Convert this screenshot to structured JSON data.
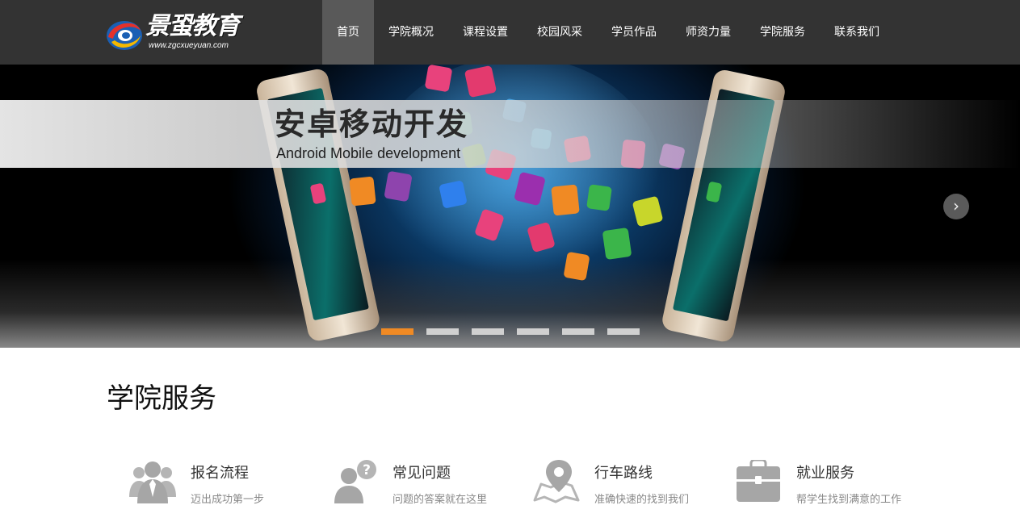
{
  "logo": {
    "name": "景蛩教育",
    "url": "www.zgcxueyuan.com"
  },
  "nav": {
    "items": [
      {
        "label": "首页",
        "active": true
      },
      {
        "label": "学院概况",
        "active": false
      },
      {
        "label": "课程设置",
        "active": false
      },
      {
        "label": "校园风采",
        "active": false
      },
      {
        "label": "学员作品",
        "active": false
      },
      {
        "label": "师资力量",
        "active": false
      },
      {
        "label": "学院服务",
        "active": false
      },
      {
        "label": "联系我们",
        "active": false
      }
    ]
  },
  "banner": {
    "title": "安卓移动开发",
    "subtitle": "Android Mobile development",
    "next_arrow": "›",
    "slide_count": 6,
    "active_slide": 1
  },
  "services": {
    "title": "学院服务",
    "items": [
      {
        "title": "报名流程",
        "subtitle": "迈出成功第一步",
        "icon": "users-icon"
      },
      {
        "title": "常见问题",
        "subtitle": "问题的答案就在这里",
        "icon": "question-user-icon"
      },
      {
        "title": "行车路线",
        "subtitle": "准确快速的找到我们",
        "icon": "map-pin-icon"
      },
      {
        "title": "就业服务",
        "subtitle": "帮学生找到满意的工作",
        "icon": "briefcase-icon"
      }
    ]
  },
  "colors": {
    "header_bg": "#333333",
    "nav_active_bg": "#595959",
    "dot_active": "#f08a24",
    "dot_inactive": "#d0d0d0",
    "icon_gray": "#b5b5b5"
  }
}
